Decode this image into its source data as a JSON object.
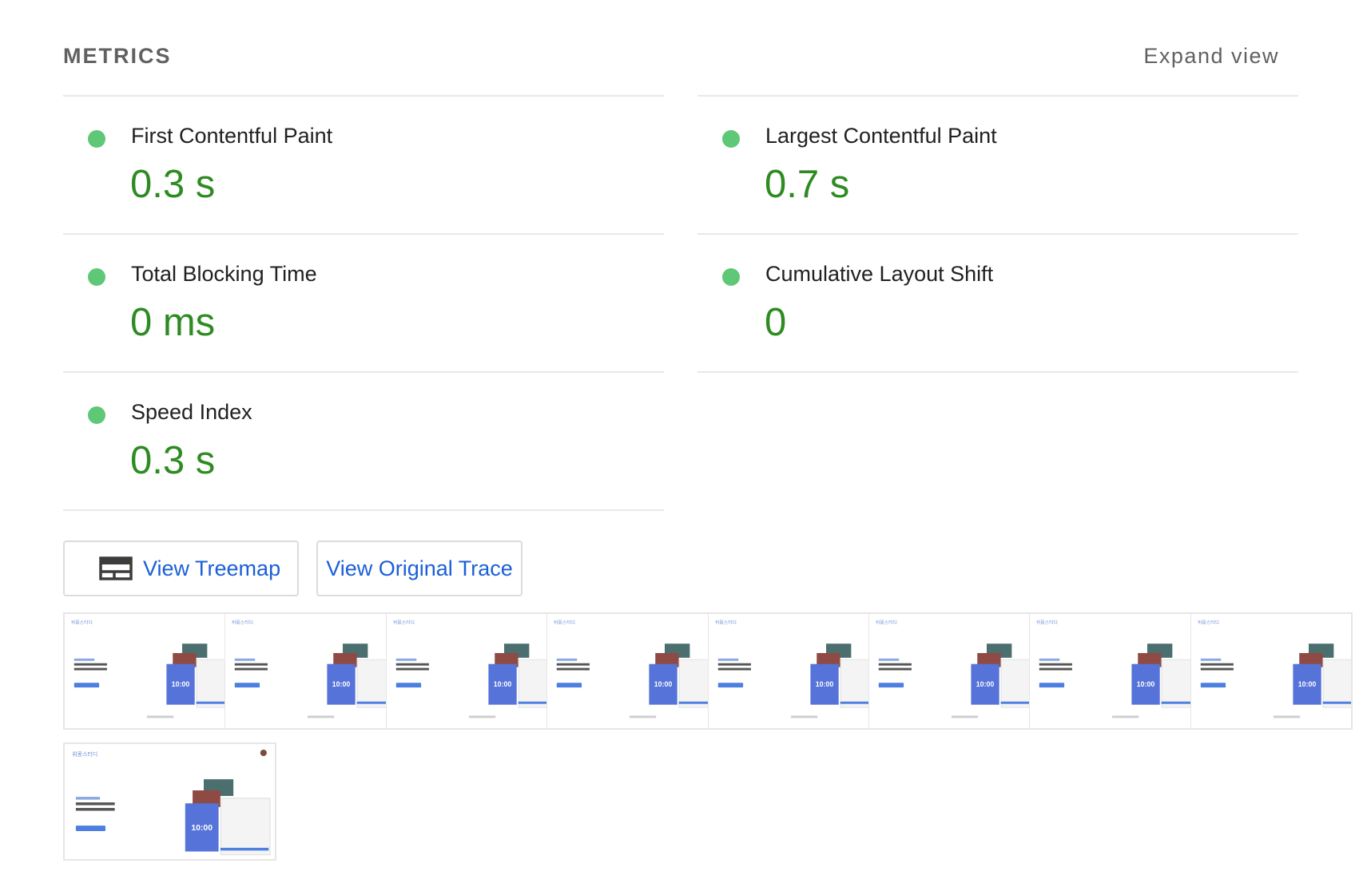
{
  "header": {
    "title": "METRICS",
    "expand_label": "Expand view"
  },
  "metrics": [
    {
      "label": "First Contentful Paint",
      "value": "0.3 s",
      "status_color": "#5ec876"
    },
    {
      "label": "Largest Contentful Paint",
      "value": "0.7 s",
      "status_color": "#5ec876"
    },
    {
      "label": "Total Blocking Time",
      "value": "0 ms",
      "status_color": "#5ec876"
    },
    {
      "label": "Cumulative Layout Shift",
      "value": "0",
      "status_color": "#5ec876"
    },
    {
      "label": "Speed Index",
      "value": "0.3 s",
      "status_color": "#5ec876"
    }
  ],
  "buttons": {
    "treemap_label": "View Treemap",
    "trace_label": "View Original Trace"
  },
  "filmstrip": {
    "frame_count": 8,
    "thumbnail": {
      "logo": "위몽스터디",
      "timer": "10:00"
    }
  },
  "colors": {
    "pass_green": "#2e8b22",
    "link_blue": "#1a5fd8",
    "dot_green": "#5ec876"
  }
}
